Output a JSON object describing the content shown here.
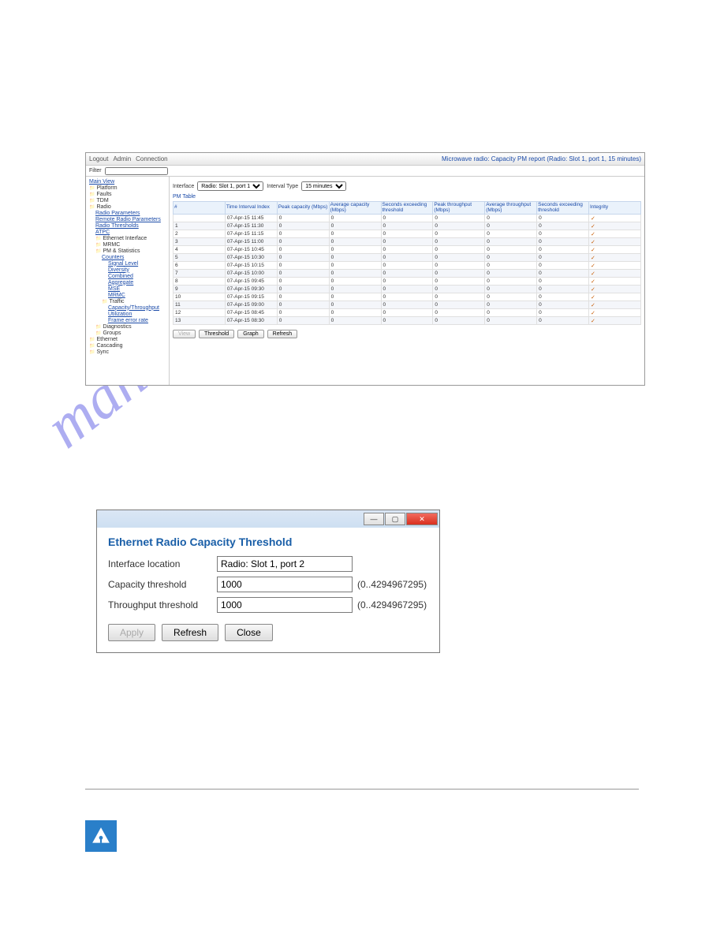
{
  "watermark": "manualshive.com",
  "screenshot1": {
    "toolbar": {
      "logout": "Logout",
      "admin": "Admin",
      "connection": "Connection"
    },
    "filter_label": "Filter",
    "header_title": "Microwave radio: Capacity PM report (Radio: Slot 1, port 1, 15 minutes)",
    "interface_label": "Interface",
    "interface_value": "Radio: Slot 1, port 1",
    "interval_label": "Interval Type",
    "interval_value": "15 minutes",
    "pm_label": "PM Table",
    "headers": [
      "#",
      "Time Interval Index",
      "Peak capacity (Mbps)",
      "Average capacity (Mbps)",
      "Seconds exceeding threshold",
      "Peak throughput (Mbps)",
      "Average throughput (Mbps)",
      "Seconds exceeding threshold",
      "Integrity"
    ],
    "rows": [
      {
        "n": "",
        "t": "07-Apr-15 11:45",
        "c": [
          "0",
          "0",
          "0",
          "0",
          "0",
          "0"
        ]
      },
      {
        "n": "1",
        "t": "07-Apr-15 11:30",
        "c": [
          "0",
          "0",
          "0",
          "0",
          "0",
          "0"
        ]
      },
      {
        "n": "2",
        "t": "07-Apr-15 11:15",
        "c": [
          "0",
          "0",
          "0",
          "0",
          "0",
          "0"
        ]
      },
      {
        "n": "3",
        "t": "07-Apr-15 11:00",
        "c": [
          "0",
          "0",
          "0",
          "0",
          "0",
          "0"
        ]
      },
      {
        "n": "4",
        "t": "07-Apr-15 10:45",
        "c": [
          "0",
          "0",
          "0",
          "0",
          "0",
          "0"
        ]
      },
      {
        "n": "5",
        "t": "07-Apr-15 10:30",
        "c": [
          "0",
          "0",
          "0",
          "0",
          "0",
          "0"
        ]
      },
      {
        "n": "6",
        "t": "07-Apr-15 10:15",
        "c": [
          "0",
          "0",
          "0",
          "0",
          "0",
          "0"
        ]
      },
      {
        "n": "7",
        "t": "07-Apr-15 10:00",
        "c": [
          "0",
          "0",
          "0",
          "0",
          "0",
          "0"
        ]
      },
      {
        "n": "8",
        "t": "07-Apr-15 09:45",
        "c": [
          "0",
          "0",
          "0",
          "0",
          "0",
          "0"
        ]
      },
      {
        "n": "9",
        "t": "07-Apr-15 09:30",
        "c": [
          "0",
          "0",
          "0",
          "0",
          "0",
          "0"
        ]
      },
      {
        "n": "10",
        "t": "07-Apr-15 09:15",
        "c": [
          "0",
          "0",
          "0",
          "0",
          "0",
          "0"
        ]
      },
      {
        "n": "11",
        "t": "07-Apr-15 09:00",
        "c": [
          "0",
          "0",
          "0",
          "0",
          "0",
          "0"
        ]
      },
      {
        "n": "12",
        "t": "07-Apr-15 08:45",
        "c": [
          "0",
          "0",
          "0",
          "0",
          "0",
          "0"
        ]
      },
      {
        "n": "13",
        "t": "07-Apr-15 08:30",
        "c": [
          "0",
          "0",
          "0",
          "0",
          "0",
          "0"
        ]
      }
    ],
    "buttons": {
      "view": "View",
      "threshold": "Threshold",
      "graph": "Graph",
      "refresh": "Refresh"
    },
    "tree": [
      {
        "l": "Main View",
        "i": 0,
        "f": true
      },
      {
        "l": "Platform",
        "i": 0,
        "fold": true
      },
      {
        "l": "Faults",
        "i": 0,
        "fold": true
      },
      {
        "l": "TDM",
        "i": 0,
        "fold": true
      },
      {
        "l": "Radio",
        "i": 0,
        "fold": true
      },
      {
        "l": "Radio Parameters",
        "i": 1,
        "f": true
      },
      {
        "l": "Remote Radio Parameters",
        "i": 1,
        "f": true
      },
      {
        "l": "Radio Thresholds",
        "i": 1,
        "f": true
      },
      {
        "l": "ATPC",
        "i": 1,
        "f": true
      },
      {
        "l": "Ethernet Interface",
        "i": 1,
        "fold": true
      },
      {
        "l": "MRMC",
        "i": 1,
        "fold": true
      },
      {
        "l": "PM & Statistics",
        "i": 1,
        "fold": true
      },
      {
        "l": "Counters",
        "i": 2,
        "f": true
      },
      {
        "l": "Signal Level",
        "i": 3,
        "f": true
      },
      {
        "l": "Diversity",
        "i": 3,
        "f": true
      },
      {
        "l": "Combined",
        "i": 3,
        "f": true
      },
      {
        "l": "Aggregate",
        "i": 3,
        "f": true
      },
      {
        "l": "MSE",
        "i": 3,
        "f": true
      },
      {
        "l": "MRMC",
        "i": 3,
        "f": true
      },
      {
        "l": "Traffic",
        "i": 2,
        "fold": true
      },
      {
        "l": "Capacity/Throughput",
        "i": 3,
        "f": true
      },
      {
        "l": "Utilization",
        "i": 3,
        "f": true
      },
      {
        "l": "Frame error rate",
        "i": 3,
        "f": true
      },
      {
        "l": "Diagnostics",
        "i": 1,
        "fold": true
      },
      {
        "l": "Groups",
        "i": 1,
        "fold": true
      },
      {
        "l": "Ethernet",
        "i": 0,
        "fold": true
      },
      {
        "l": "Cascading",
        "i": 0,
        "fold": true
      },
      {
        "l": "Sync",
        "i": 0,
        "fold": true
      }
    ]
  },
  "dialog": {
    "title": "Ethernet Radio Capacity Threshold",
    "fields": {
      "loc_label": "Interface location",
      "loc_value": "Radio: Slot 1, port 2",
      "cap_label": "Capacity threshold",
      "cap_value": "1000",
      "cap_hint": "(0..4294967295)",
      "thr_label": "Throughput threshold",
      "thr_value": "1000",
      "thr_hint": "(0..4294967295)"
    },
    "buttons": {
      "apply": "Apply",
      "refresh": "Refresh",
      "close": "Close"
    }
  }
}
